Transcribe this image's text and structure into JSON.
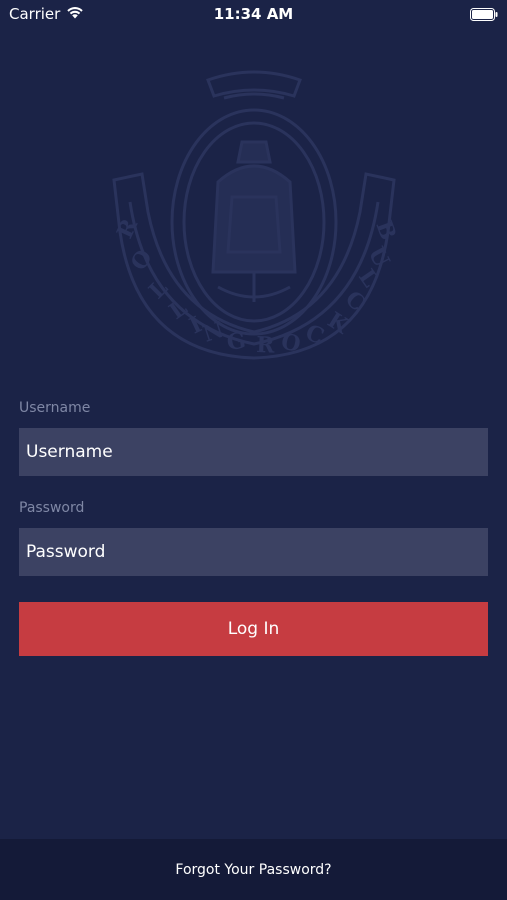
{
  "status_bar": {
    "carrier": "Carrier",
    "time": "11:34 AM",
    "icons": [
      "wifi-icon",
      "battery-icon"
    ]
  },
  "logo": {
    "name": "club-crest-logo",
    "text": "ROLLING ROCK CLUB"
  },
  "form": {
    "username_label": "Username",
    "username_placeholder": "Username",
    "password_label": "Password",
    "password_placeholder": "Password",
    "login_label": "Log In"
  },
  "footer": {
    "forgot_label": "Forgot Your Password?"
  },
  "colors": {
    "background": "#1b2347",
    "input_bg": "#3c4263",
    "button": "#c63c41",
    "footer_bg": "#141a38",
    "label": "#7f87a5"
  }
}
